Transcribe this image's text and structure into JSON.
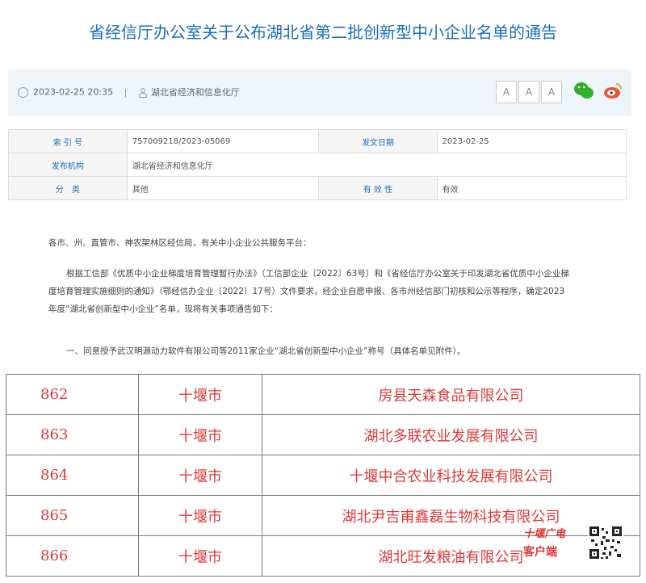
{
  "title": "省经信厅办公室关于公布湖北省第二批创新型中小企业名单的通告",
  "info": {
    "datetime": "2023-02-25 20:35",
    "divider": "|",
    "publisher": "湖北省经济和信息化厅"
  },
  "font_buttons": [
    "A",
    "A",
    "A"
  ],
  "icons": {
    "clock": "clock-icon",
    "user": "user-icon",
    "wechat": "wechat-icon",
    "weibo": "weibo-icon"
  },
  "meta": {
    "index_label": "索 引 号",
    "index_value": "757009218/2023-05069",
    "date_label": "发文日期",
    "date_value": "2023-02-25",
    "org_label": "发布机构",
    "org_value": "湖北省经济和信息化厅",
    "cat_label": "分　类",
    "cat_value": "其他",
    "valid_label": "有 效 性",
    "valid_value": "有效"
  },
  "body": {
    "salutation": "各市、州、直管市、神农架林区经信局，有关中小企业公共服务平台：",
    "p1_line1": "根据工信部《优质中小企业梯度培育管理暂行办法》（工信部企业〔2022〕63号）和《省经信厅办公室关于印发湖北省优质中小企业梯",
    "p1_line2": "度培育管理实施细则的通知》（鄂经信办企业〔2022〕17号）文件要求，经企业自愿申报、各市州经信部门初核和公示等程序，确定2023",
    "p1_line3": "年度“湖北省创新型中小企业”名单，现将有关事项通告如下：",
    "p2": "一、同意授予武汉明源动力软件有限公司等2011家企业“湖北省创新型中小企业”称号（具体名单见附件）。"
  },
  "rows": [
    {
      "num": "862",
      "city": "十堰市",
      "company": "房县天森食品有限公司"
    },
    {
      "num": "863",
      "city": "十堰市",
      "company": "湖北多联农业发展有限公司"
    },
    {
      "num": "864",
      "city": "十堰市",
      "company": "十堰中合农业科技发展有限公司"
    },
    {
      "num": "865",
      "city": "十堰市",
      "company": "湖北尹吉甫鑫磊生物科技有限公司"
    },
    {
      "num": "866",
      "city": "十堰市",
      "company": "湖北旺发粮油有限公司"
    }
  ],
  "watermark": {
    "line1": "十堰广电",
    "line2": "客户端"
  },
  "colors": {
    "title": "#1a6fc0",
    "accent_red": "#e03838",
    "infobar_bg": "#edf5fb"
  }
}
